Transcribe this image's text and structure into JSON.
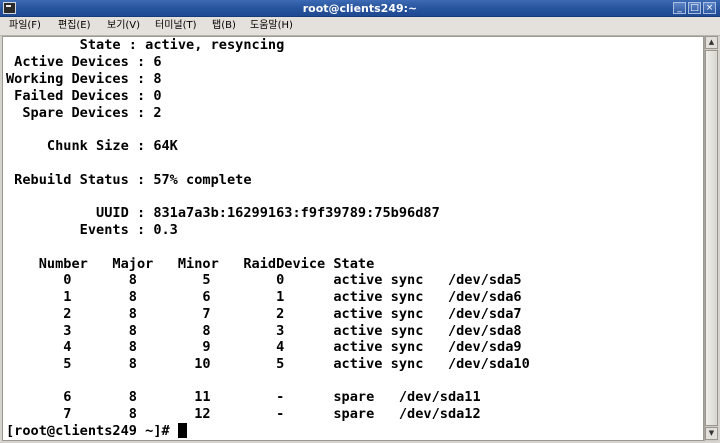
{
  "window": {
    "title": "root@clients249:~",
    "buttons": {
      "minimize": "_",
      "maximize": "□",
      "close": "×"
    }
  },
  "menu": [
    "파일(F)",
    "편집(E)",
    "보기(V)",
    "터미널(T)",
    "탭(B)",
    "도움말(H)"
  ],
  "terminal": {
    "lines": [
      "         State : active, resyncing",
      " Active Devices : 6",
      "Working Devices : 8",
      " Failed Devices : 0",
      "  Spare Devices : 2",
      "",
      "     Chunk Size : 64K",
      "",
      " Rebuild Status : 57% complete",
      "",
      "           UUID : 831a7a3b:16299163:f9f39789:75b96d87",
      "         Events : 0.3",
      "",
      "    Number   Major   Minor   RaidDevice State",
      "       0       8        5        0      active sync   /dev/sda5",
      "       1       8        6        1      active sync   /dev/sda6",
      "       2       8        7        2      active sync   /dev/sda7",
      "       3       8        8        3      active sync   /dev/sda8",
      "       4       8        9        4      active sync   /dev/sda9",
      "       5       8       10        5      active sync   /dev/sda10",
      "",
      "       6       8       11        -      spare   /dev/sda11",
      "       7       8       12        -      spare   /dev/sda12"
    ],
    "prompt": "[root@clients249 ~]# "
  },
  "scrollbar": {
    "up": "▲",
    "down": "▼"
  }
}
